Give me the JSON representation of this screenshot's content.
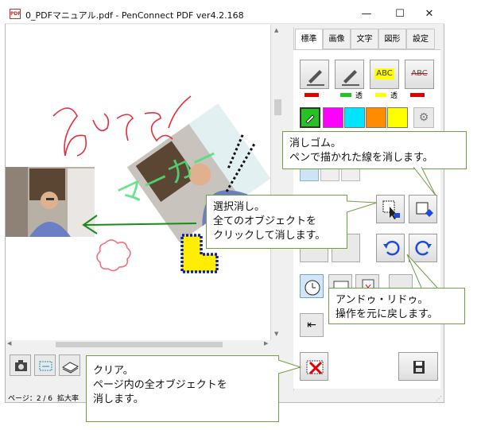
{
  "window": {
    "title": "0_PDFマニュアル.pdf - PenConnect PDF ver4.2.168",
    "minimize": "—",
    "maximize": "☐",
    "close": "✕"
  },
  "canvas": {
    "handwriting": "あいうえ",
    "marker_text": "マーカー"
  },
  "tabs": [
    "標準",
    "画像",
    "文字",
    "図形",
    "設定"
  ],
  "tools": {
    "abc1": "ABC",
    "abc2": "ABC",
    "transparent_label": "透"
  },
  "colors": {
    "palette": [
      "#22c322",
      "#ff00ff",
      "#00e5ff",
      "#ff8c00",
      "#ffff00"
    ],
    "accent": "#6f9e45"
  },
  "status": {
    "page": "ページ：2 / 6",
    "zoom": "拡大率"
  },
  "callouts": {
    "eraser_line1": "消しゴム。",
    "eraser_line2": "ペンで描かれた線を消します。",
    "select_line1": "選択消し。",
    "select_line2": "全てのオブジェクトを",
    "select_line3": "クリックして消します。",
    "undo_line1": "アンドゥ・リドゥ。",
    "undo_line2": "操作を元に戻します。",
    "clear_line1": "クリア。",
    "clear_line2": "ページ内の全オブジェクトを",
    "clear_line3": "消します。"
  }
}
